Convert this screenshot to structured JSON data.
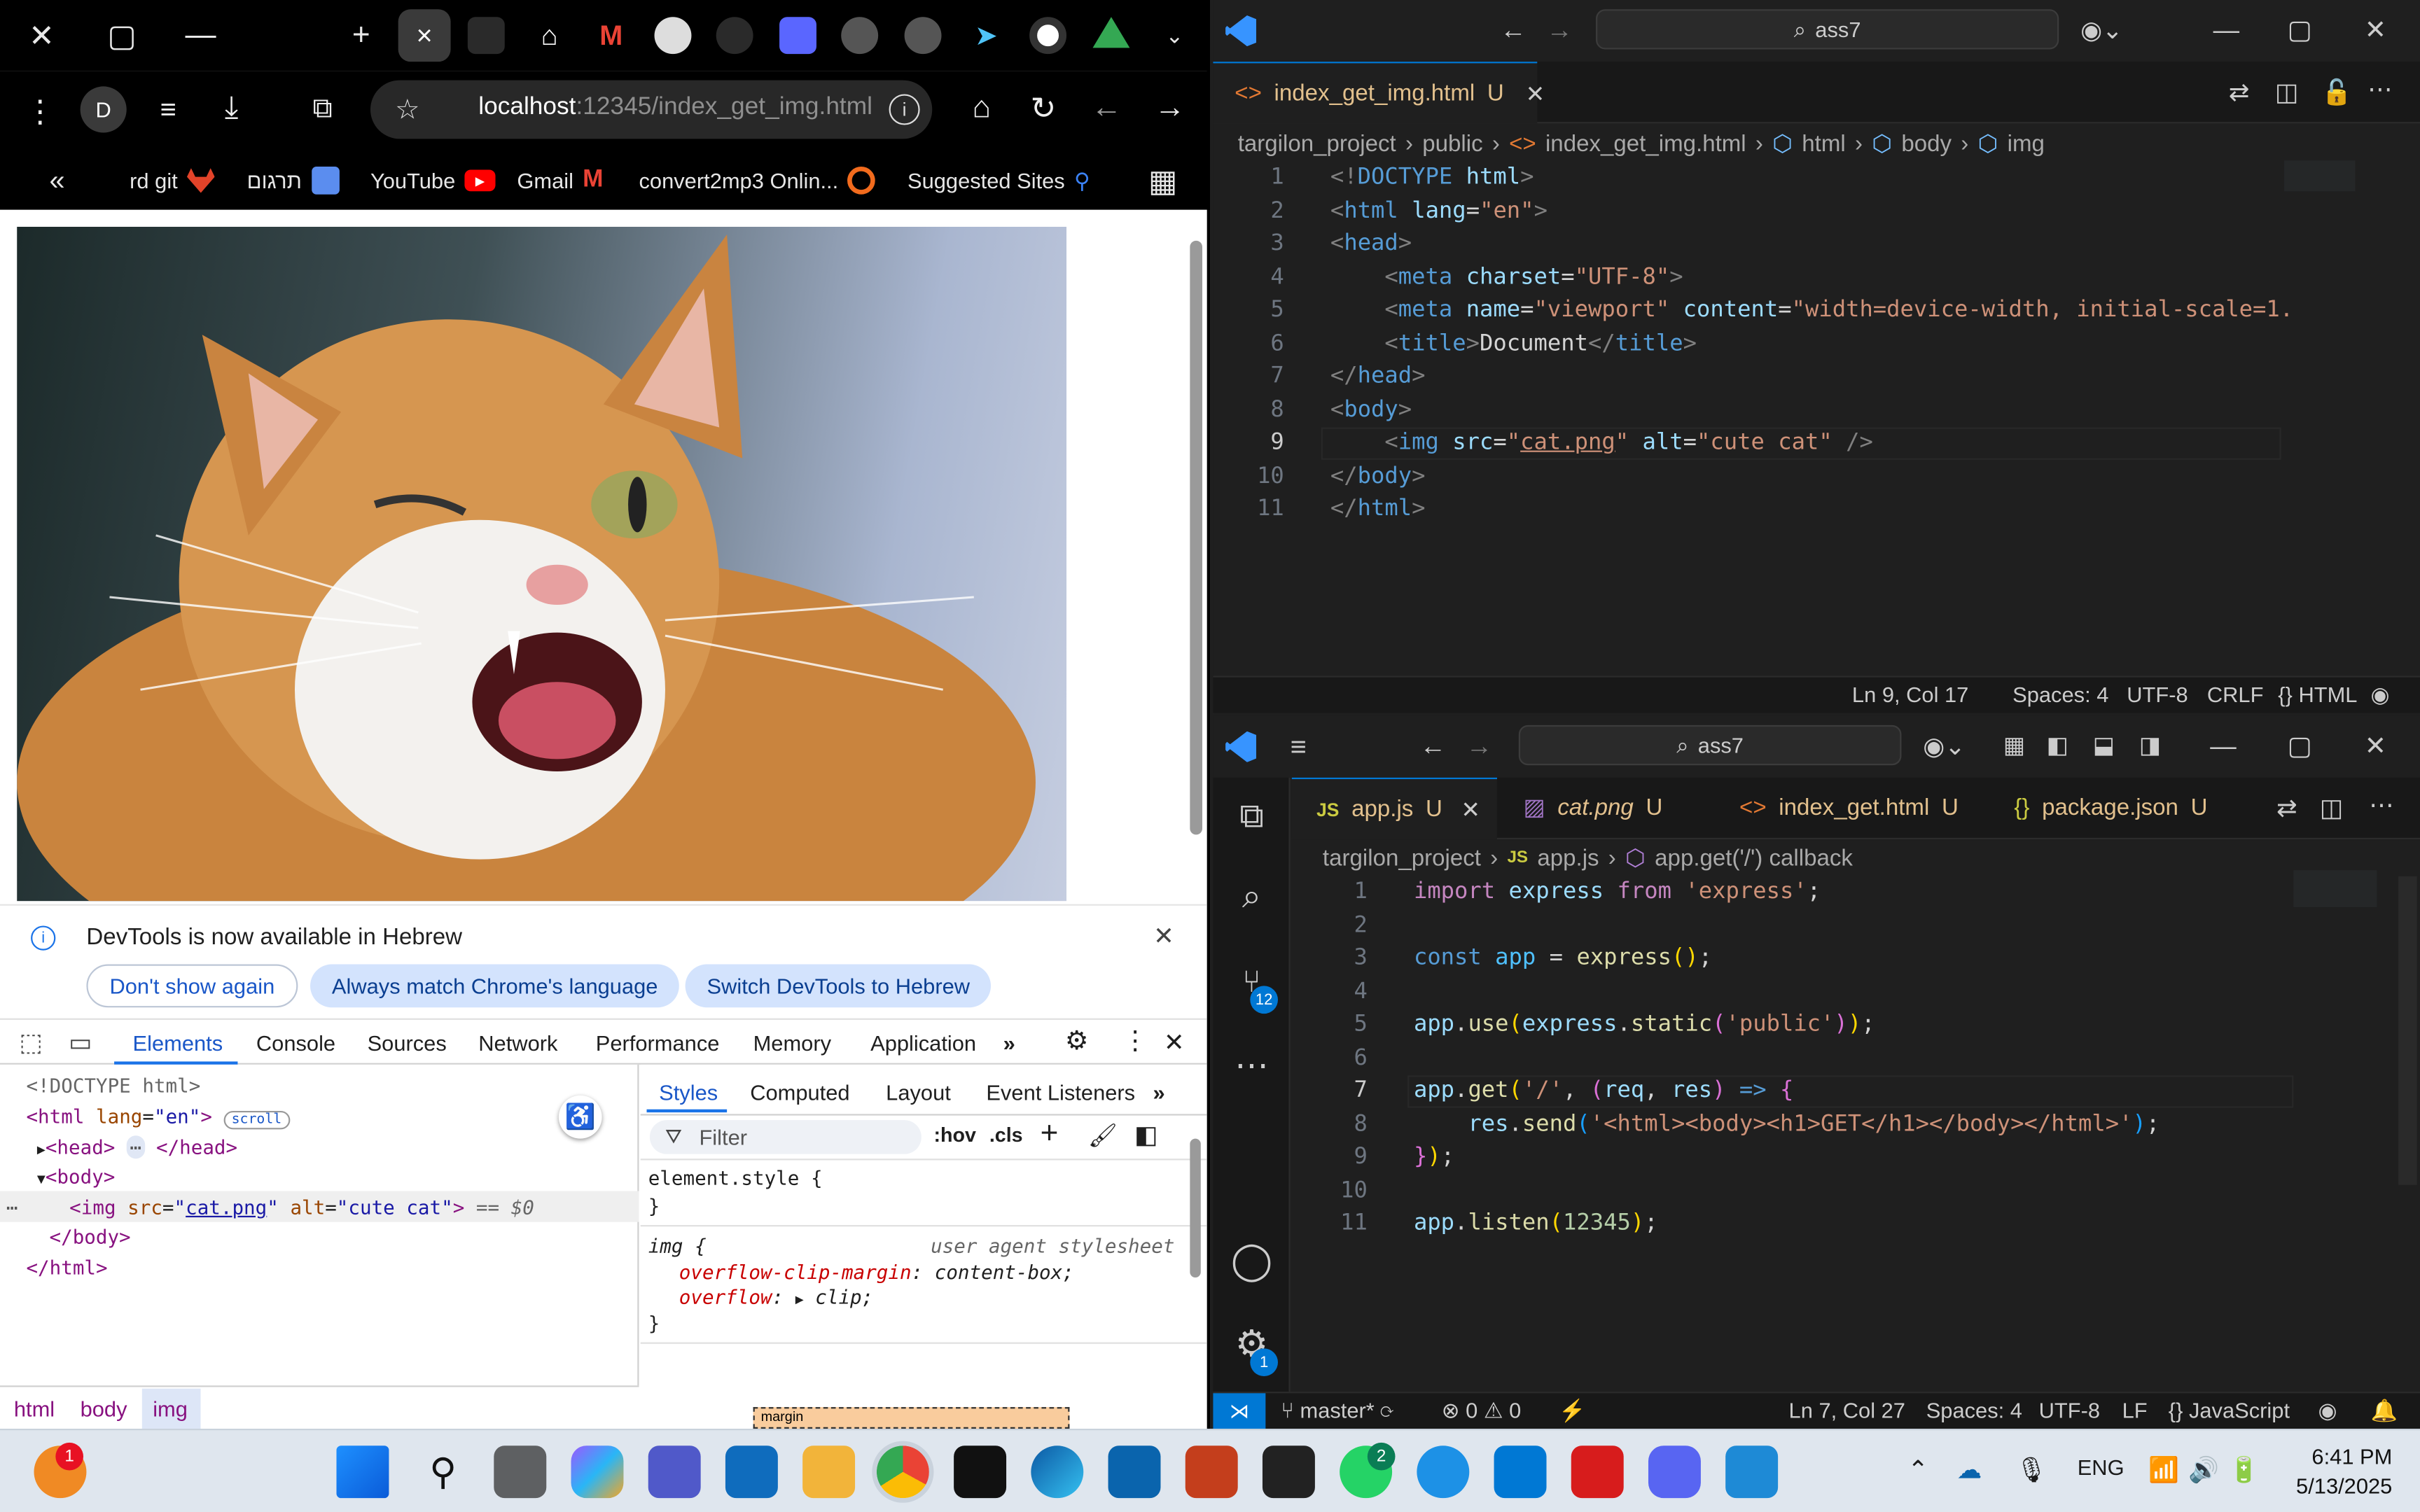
{
  "chrome": {
    "tab_close": "×",
    "omnibox_host": "localhost",
    "omnibox_path": ":12345/index_get_img.html",
    "profile_initial": "D",
    "bookmarks": [
      {
        "label": "rd git"
      },
      {
        "label": "תרגום"
      },
      {
        "label": "YouTube"
      },
      {
        "label": "Gmail"
      },
      {
        "label": "convert2mp3 Onlin..."
      },
      {
        "label": "Suggested Sites"
      }
    ],
    "bookmarks_overflow": "«",
    "infobar": {
      "message": "DevTools is now available in Hebrew",
      "btn_dont_show": "Don't show again",
      "btn_match": "Always match Chrome's language",
      "btn_switch": "Switch DevTools to Hebrew"
    },
    "devtools_tabs": [
      "Elements",
      "Console",
      "Sources",
      "Network",
      "Performance",
      "Memory",
      "Application"
    ],
    "dom": {
      "doctype": "<!DOCTYPE html>",
      "scroll_badge": "scroll",
      "selected_suffix": "== $0",
      "img_src": "cat.png",
      "img_alt": "cute cat"
    },
    "styles_tabs": [
      "Styles",
      "Computed",
      "Layout",
      "Event Listeners"
    ],
    "filter_placeholder": "Filter",
    "hov": ":hov",
    "cls": ".cls",
    "element_style": "element.style {",
    "close_brace": "}",
    "img_rule": "img {",
    "ua_label": "user agent stylesheet",
    "prop1_name": "overflow-clip-margin",
    "prop1_value": "content-box;",
    "prop2_name": "overflow",
    "prop2_value": "clip;",
    "margin_label": "margin",
    "breadcrumb": [
      "html",
      "body",
      "img"
    ]
  },
  "vs_top": {
    "search": "ass7",
    "tab_label": "index_get_img.html",
    "tab_status": "U",
    "breadcrumb": [
      "targilon_project",
      "public",
      "index_get_img.html",
      "html",
      "body",
      "img"
    ],
    "active_line": 9,
    "status": {
      "position": "Ln 9, Col 17",
      "spaces": "Spaces: 4",
      "encoding": "UTF-8",
      "eol": "CRLF",
      "language": "HTML"
    }
  },
  "vs_bottom": {
    "search": "ass7",
    "tabs": [
      {
        "label": "app.js",
        "status": "U",
        "prefix": "JS"
      },
      {
        "label": "cat.png",
        "status": "U",
        "prefix": ""
      },
      {
        "label": "index_get.html",
        "status": "U",
        "prefix": "<>"
      },
      {
        "label": "package.json",
        "status": "U",
        "prefix": "{}"
      }
    ],
    "breadcrumb": [
      "targilon_project",
      "app.js",
      "app.get('/') callback"
    ],
    "scm_badge": "12",
    "settings_badge": "1",
    "active_line": 7,
    "status": {
      "branch": "master*",
      "errors": "0",
      "warnings": "0",
      "position": "Ln 7, Col 27",
      "spaces": "Spaces: 4",
      "encoding": "UTF-8",
      "eol": "LF",
      "language": "JavaScript"
    }
  },
  "taskbar": {
    "notify_badge": "1",
    "whatsapp_badge": "2",
    "lang": "ENG",
    "time": "6:41 PM",
    "date": "5/13/2025"
  },
  "colors": {
    "accent": "#0078d4",
    "vs_bg": "#1f1f1f",
    "chrome_bg": "#000000",
    "devtools_blue": "#1a73e8"
  }
}
